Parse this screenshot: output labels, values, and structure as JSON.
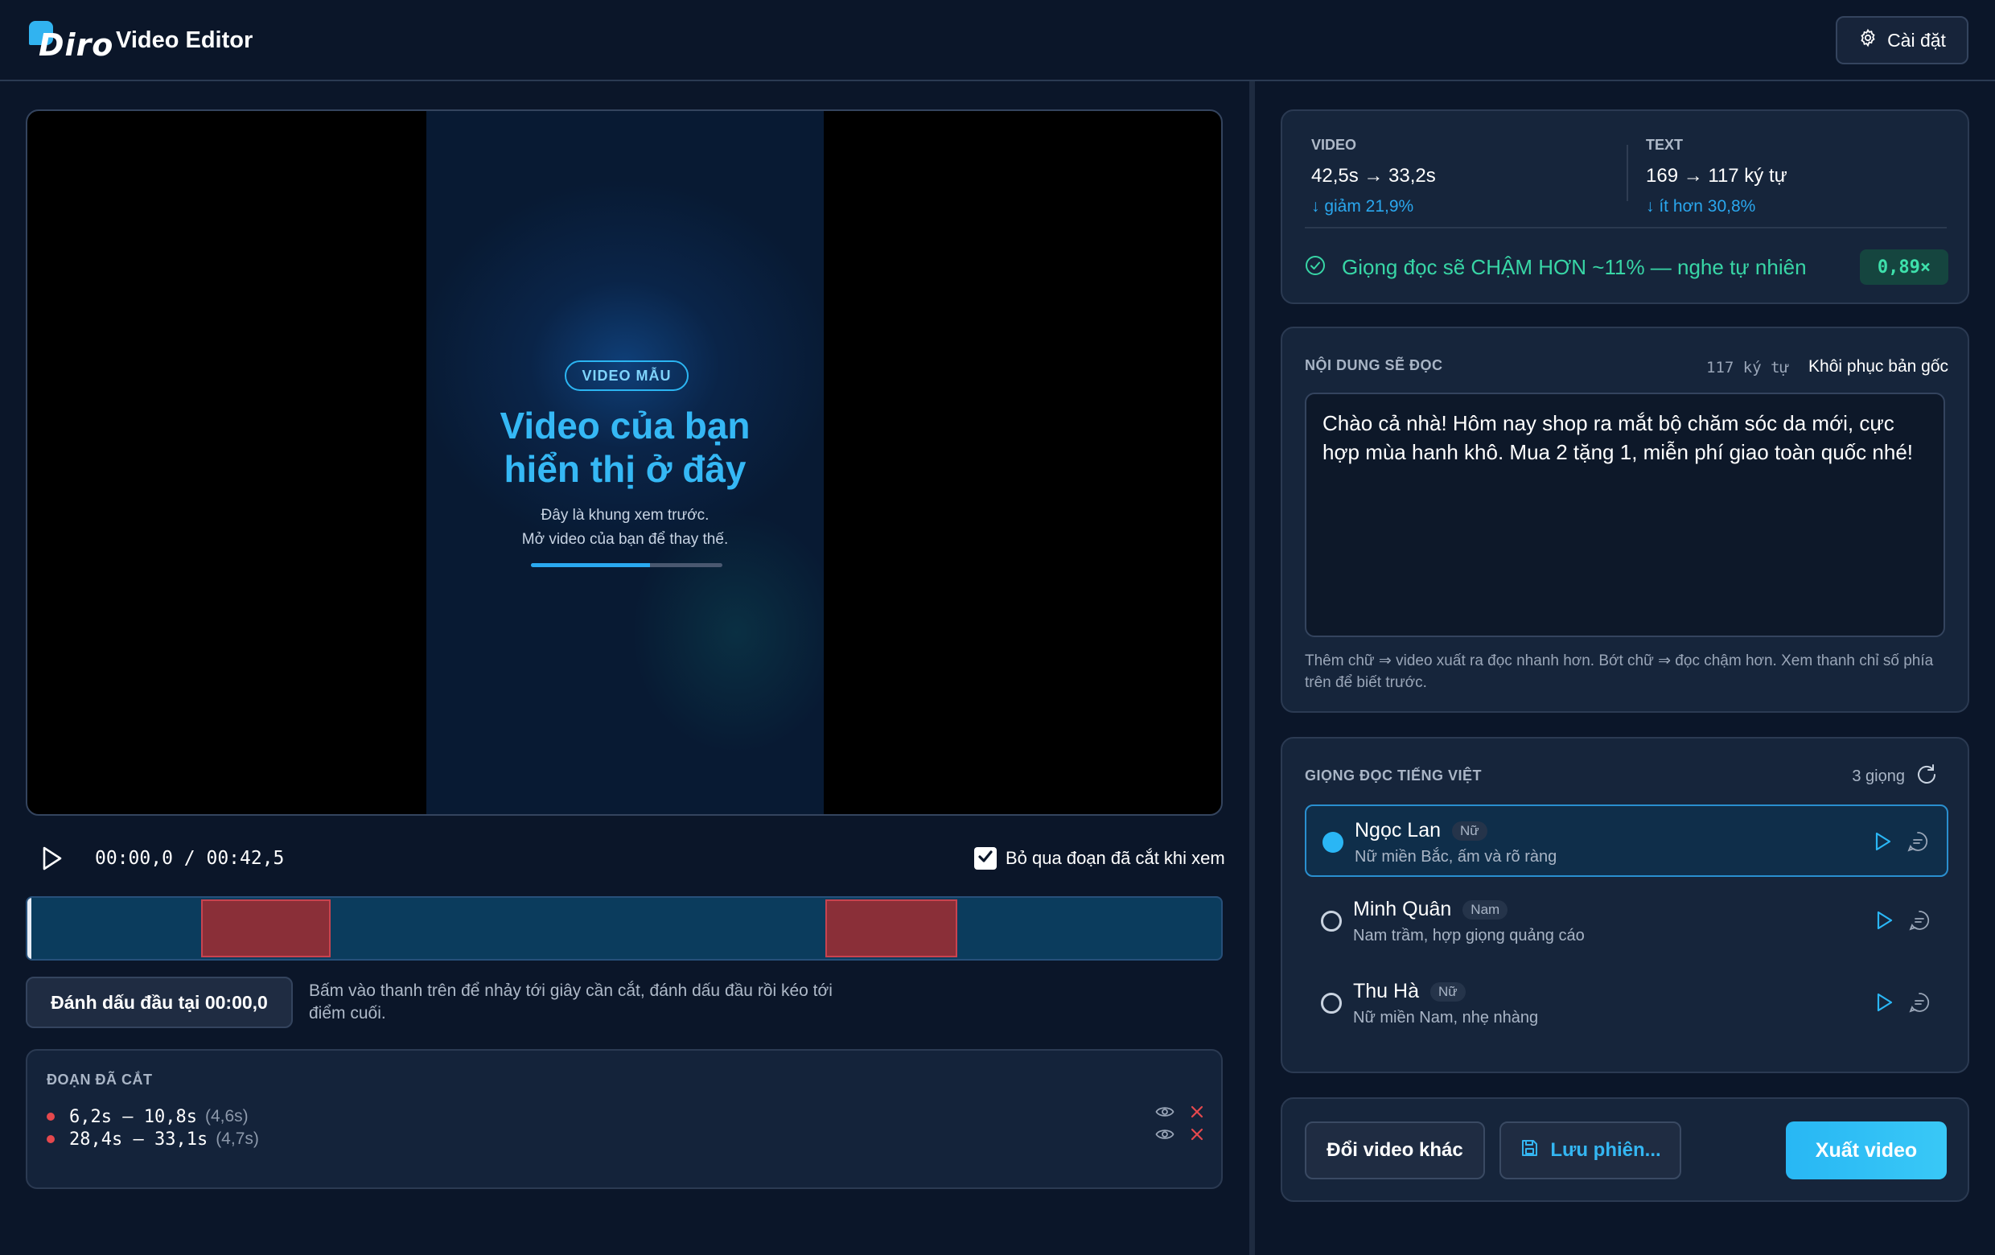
{
  "header": {
    "logo_text": "Diro",
    "title": "Video Editor",
    "settings_label": "Cài đặt"
  },
  "preview": {
    "badge": "VIDEO MẪU",
    "title_line1": "Video của bạn",
    "title_line2": "hiển thị ở đây",
    "sub_line1": "Đây là khung xem trước.",
    "sub_line2": "Mở video của bạn để thay thế.",
    "progress": 0.62
  },
  "player": {
    "timecode": "00:00,0 / 00:42,5",
    "skip_label": "Bỏ qua đoạn đã cắt khi xem",
    "skip_checked": true,
    "duration_s": 42.5,
    "playhead_s": 0
  },
  "timeline": {
    "cuts": [
      {
        "start": 6.2,
        "end": 10.8
      },
      {
        "start": 28.4,
        "end": 33.1
      }
    ]
  },
  "marker": {
    "button_label": "Đánh dấu đầu tại 00:00,0",
    "help": "Bấm vào thanh trên để nhảy tới giây cần cắt, đánh dấu đầu rồi kéo tới điểm cuối."
  },
  "cuts_panel": {
    "title": "ĐOẠN ĐÃ CẮT",
    "items": [
      {
        "range": "6,2s – 10,8s",
        "duration": "(4,6s)"
      },
      {
        "range": "28,4s – 33,1s",
        "duration": "(4,7s)"
      }
    ]
  },
  "stats": {
    "video_label": "VIDEO",
    "video_value": "42,5s → 33,2s",
    "video_change": "↓ giảm 21,9%",
    "text_label": "TEXT",
    "text_value": "169 → 117 ký tự",
    "text_change": "↓ ít hơn 30,8%",
    "voice_note": "Giọng đọc sẽ CHẬM HƠN ~11% — nghe tự nhiên",
    "speed": "0,89×"
  },
  "content": {
    "title": "NỘI DUNG SẼ ĐỌC",
    "char_count": "117 ký tự",
    "restore_label": "Khôi phục bản gốc",
    "script": "Chào cả nhà! Hôm nay shop ra mắt bộ chăm sóc da mới, cực hợp mùa hanh khô. Mua 2 tặng 1, miễn phí giao toàn quốc nhé!",
    "hint": "Thêm chữ ⇒ video xuất ra đọc nhanh hơn. Bớt chữ ⇒ đọc chậm hơn. Xem thanh chỉ số phía trên để biết trước."
  },
  "voices": {
    "title": "GIỌNG ĐỌC TIẾNG VIỆT",
    "count": "3 giọng",
    "items": [
      {
        "name": "Ngọc Lan",
        "gender": "Nữ",
        "desc": "Nữ miền Bắc, ấm và rõ ràng",
        "selected": true
      },
      {
        "name": "Minh Quân",
        "gender": "Nam",
        "desc": "Nam trầm, hợp giọng quảng cáo",
        "selected": false
      },
      {
        "name": "Thu Hà",
        "gender": "Nữ",
        "desc": "Nữ miền Nam, nhẹ nhàng",
        "selected": false
      }
    ]
  },
  "actions": {
    "change_video": "Đổi video khác",
    "save_session": "Lưu phiên...",
    "export": "Xuất video"
  },
  "colors": {
    "accent": "#2ab6f5",
    "success": "#38d6a6",
    "cut": "#8a2f38",
    "danger": "#e5484d"
  }
}
